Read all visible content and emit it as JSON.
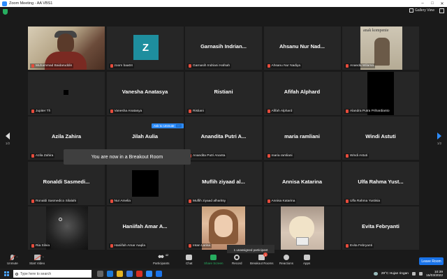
{
  "window": {
    "title": "Zoom Meeting - AA VBS1"
  },
  "meeting": {
    "gallery_view_label": "Gallery View",
    "page_left": "1/2",
    "page_right": "1/2"
  },
  "tiles": [
    {
      "label": "Muhammad Baidaruddin",
      "type": "video"
    },
    {
      "label": "zoom baa04",
      "type": "avatar",
      "avatar_letter": "Z",
      "avatar_color": "#1e8e9e"
    },
    {
      "label": "Garnasih Indriani Hafsah",
      "type": "name",
      "big": "Garnasih Indrian..."
    },
    {
      "label": "Ahsanu Nur Nadiya",
      "type": "name",
      "big": "Ahsanu Nur Nad..."
    },
    {
      "label": "Ananda Wilama",
      "type": "photo-book",
      "book_text": "anak kompenie"
    },
    {
      "label": "Jupiter Th",
      "type": "small-black"
    },
    {
      "label": "Vanesha Anatasya",
      "type": "name",
      "big": "Vanesha Anatasya"
    },
    {
      "label": "Ristiani",
      "type": "name",
      "big": "Ristiani"
    },
    {
      "label": "Afifah Alphard",
      "type": "name",
      "big": "Afifah Alphard"
    },
    {
      "label": "Alandra Putra Prihardianto",
      "type": "big-black"
    },
    {
      "label": "Azila Zahira",
      "type": "name",
      "big": "Azila Zahira"
    },
    {
      "label": "Jilah Aulia",
      "type": "name",
      "big": "Jilah Aulia"
    },
    {
      "label": "Anandita Putri Ananta",
      "type": "name",
      "big": "Anandita Putri A..."
    },
    {
      "label": "maria ramliani",
      "type": "name",
      "big": "maria ramliani"
    },
    {
      "label": "Windi Astuti",
      "type": "name",
      "big": "Windi Astuti"
    },
    {
      "label": "Ronaldi Sasmedico Silalahi",
      "type": "name",
      "big": "Ronaldi Sasmedi..."
    },
    {
      "label": "Nur Amelia",
      "type": "mid-black"
    },
    {
      "label": "Muflih ziyaad alharitsy",
      "type": "name",
      "big": "Muflih ziyaad al..."
    },
    {
      "label": "Annisa Katarina",
      "type": "name",
      "big": "Annisa Katarina"
    },
    {
      "label": "Ulfa Rahma Yustisia",
      "type": "name",
      "big": "Ulfa Rahma Yust..."
    },
    {
      "label": "Ria Silvia",
      "type": "photo-night"
    },
    {
      "label": "Haniifah Amar Aaqila",
      "type": "name",
      "big": "Haniifah Amar A..."
    },
    {
      "label": "Intan Larisa",
      "type": "photo-girl"
    },
    {
      "label": "",
      "type": "photo-blond"
    },
    {
      "label": "Evita Febryanti",
      "type": "name",
      "big": "Evita Febryanti"
    }
  ],
  "overlays": {
    "add_to_unmute": "Ask to Unmute",
    "breakout_toast": "You are now in a Breakout Room",
    "unassigned": "1 unassigned participant"
  },
  "toolbar": {
    "unmute": "Unmute",
    "start_video": "Start Video",
    "participants": "Participants",
    "participants_count": "42",
    "chat": "Chat",
    "share_screen": "Share Screen",
    "record": "Record",
    "breakout_rooms": "Breakout Rooms",
    "breakout_badge": "1",
    "reactions": "Reactions",
    "apps": "Apps",
    "leave": "Leave Room"
  },
  "taskbar": {
    "search_placeholder": "Type here to search",
    "weather": "29°C  Hujan ringan",
    "time": "10:39",
    "date": "15/03/2022"
  },
  "colors": {
    "accent": "#2d8cff",
    "active_speaker": "#e6e600",
    "muted": "#e74c3c",
    "share": "#27ae60"
  }
}
